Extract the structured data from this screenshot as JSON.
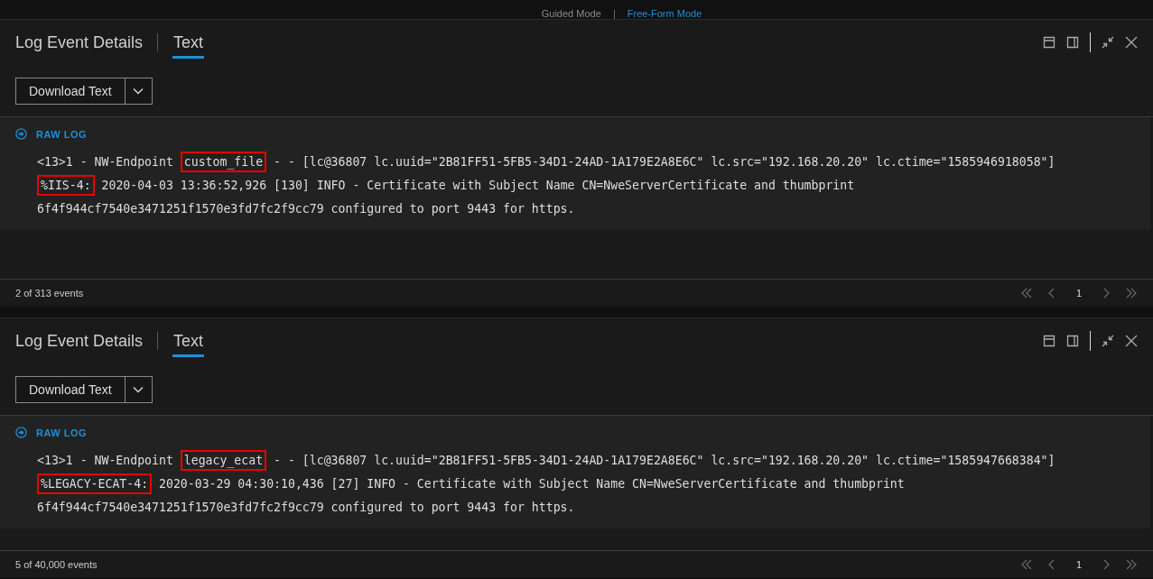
{
  "mode_switch": [
    {
      "label": "Guided Mode",
      "selected": false
    },
    {
      "label": "Free-Form Mode",
      "selected": true
    }
  ],
  "panels": [
    {
      "title": "Log Event Details",
      "tabs": [
        {
          "label": "Text",
          "selected": true
        }
      ],
      "download_button": "Download Text",
      "section_title": "RAW LOG",
      "log_lines": [
        [
          {
            "text": "<13>1 - NW-Endpoint ",
            "highlight": false
          },
          {
            "text": "custom_file",
            "highlight": true
          },
          {
            "text": " - - [lc@36807 lc.uuid=\"2B81FF51-5FB5-34D1-24AD-1A179E2A8E6C\" lc.src=\"192.168.20.20\" lc.ctime=\"1585946918058\"]",
            "highlight": false
          }
        ],
        [
          {
            "text": "%IIS-4:",
            "highlight": true
          },
          {
            "text": " 2020-04-03 13:36:52,926 [130] INFO - Certificate with Subject Name CN=NweServerCertificate and thumbprint",
            "highlight": false
          }
        ],
        [
          {
            "text": "6f4f944cf7540e3471251f1570e3fd7fc2f9cc79 configured to port 9443 for https.",
            "highlight": false
          }
        ]
      ],
      "event_count": "2 of 313 events",
      "page": "1"
    },
    {
      "title": "Log Event Details",
      "tabs": [
        {
          "label": "Text",
          "selected": true
        }
      ],
      "download_button": "Download Text",
      "section_title": "RAW LOG",
      "log_lines": [
        [
          {
            "text": "<13>1 - NW-Endpoint ",
            "highlight": false
          },
          {
            "text": "legacy_ecat",
            "highlight": true
          },
          {
            "text": " - - [lc@36807 lc.uuid=\"2B81FF51-5FB5-34D1-24AD-1A179E2A8E6C\" lc.src=\"192.168.20.20\" lc.ctime=\"1585947668384\"]",
            "highlight": false
          }
        ],
        [
          {
            "text": "%LEGACY-ECAT-4:",
            "highlight": true
          },
          {
            "text": " 2020-03-29 04:30:10,436 [27] INFO - Certificate with Subject Name CN=NweServerCertificate and thumbprint",
            "highlight": false
          }
        ],
        [
          {
            "text": "6f4f944cf7540e3471251f1570e3fd7fc2f9cc79 configured to port 9443 for https.",
            "highlight": false
          }
        ]
      ],
      "event_count": "5 of 40,000 events",
      "page": "1"
    }
  ]
}
